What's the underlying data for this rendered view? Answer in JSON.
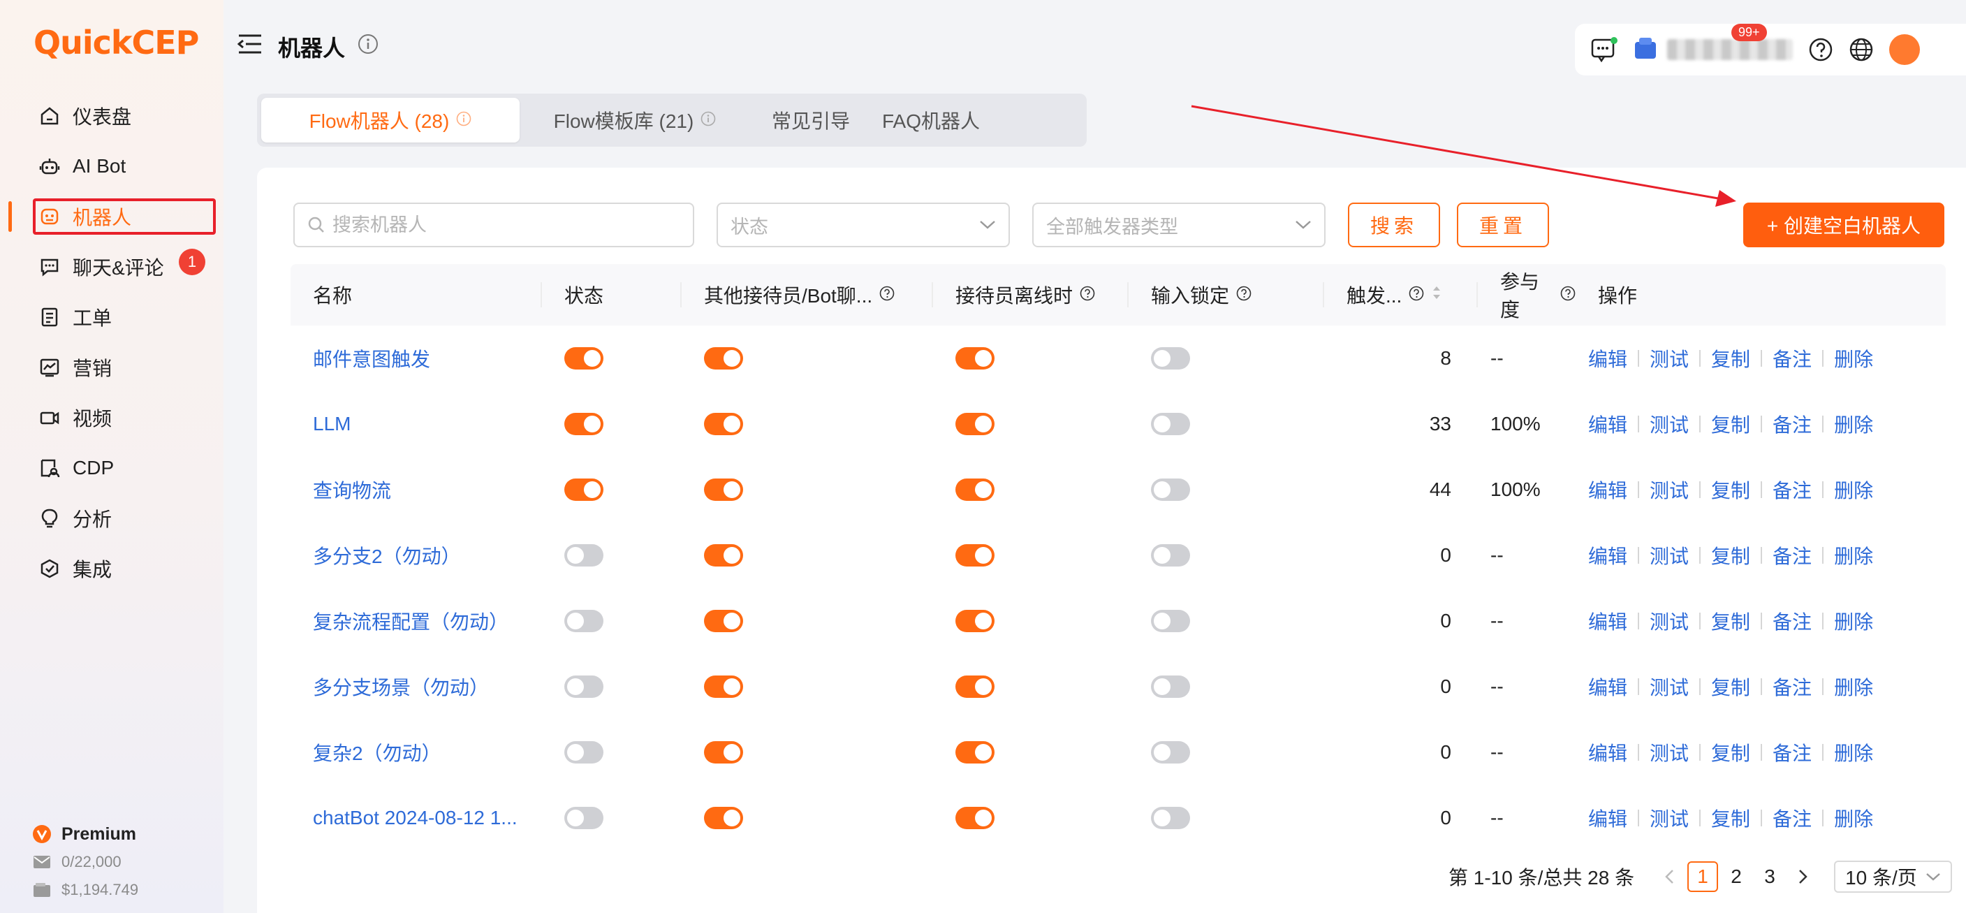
{
  "brand": {
    "logo_text": "QuickCEP",
    "accent": "#ff6a12"
  },
  "sidebar": {
    "items": [
      {
        "label": "仪表盘",
        "icon": "home-icon"
      },
      {
        "label": "AI Bot",
        "icon": "robot-icon"
      },
      {
        "label": "机器人",
        "icon": "bot-icon",
        "active": true
      },
      {
        "label": "聊天&评论",
        "icon": "chat-icon",
        "badge": "1"
      },
      {
        "label": "工单",
        "icon": "ticket-icon"
      },
      {
        "label": "营销",
        "icon": "marketing-icon"
      },
      {
        "label": "视频",
        "icon": "video-icon"
      },
      {
        "label": "CDP",
        "icon": "cdp-icon"
      },
      {
        "label": "分析",
        "icon": "bulb-icon"
      },
      {
        "label": "集成",
        "icon": "integration-icon"
      }
    ],
    "plan": {
      "name": "Premium",
      "emails": "0/22,000",
      "balance": "$1,194.749"
    }
  },
  "header": {
    "title": "机器人",
    "notification_badge": "99+"
  },
  "tabs": [
    {
      "label": "Flow机器人 (28)",
      "active": true,
      "info": true
    },
    {
      "label": "Flow模板库 (21)",
      "active": false,
      "info": true
    },
    {
      "label": "常见引导",
      "active": false,
      "info": false
    },
    {
      "label": "FAQ机器人",
      "active": false,
      "info": false
    }
  ],
  "filters": {
    "search_placeholder": "搜索机器人",
    "status_placeholder": "状态",
    "trigger_placeholder": "全部触发器类型",
    "search_button": "搜索",
    "reset_button": "重置",
    "create_button": "+ 创建空白机器人"
  },
  "table": {
    "columns": [
      "名称",
      "状态",
      "其他接待员/Bot聊...",
      "接待员离线时",
      "输入锁定",
      "触发...",
      "参与度",
      "操作"
    ],
    "actions": [
      "编辑",
      "测试",
      "复制",
      "备注",
      "删除"
    ],
    "rows": [
      {
        "name": "邮件意图触发",
        "status": true,
        "other": true,
        "offline": true,
        "lock": false,
        "trigger": "8",
        "engage": "--"
      },
      {
        "name": "LLM",
        "status": true,
        "other": true,
        "offline": true,
        "lock": false,
        "trigger": "33",
        "engage": "100%"
      },
      {
        "name": "查询物流",
        "status": true,
        "other": true,
        "offline": true,
        "lock": false,
        "trigger": "44",
        "engage": "100%"
      },
      {
        "name": "多分支2（勿动）",
        "status": false,
        "other": true,
        "offline": true,
        "lock": false,
        "trigger": "0",
        "engage": "--"
      },
      {
        "name": "复杂流程配置（勿动）",
        "status": false,
        "other": true,
        "offline": true,
        "lock": false,
        "trigger": "0",
        "engage": "--"
      },
      {
        "name": "多分支场景（勿动）",
        "status": false,
        "other": true,
        "offline": true,
        "lock": false,
        "trigger": "0",
        "engage": "--"
      },
      {
        "name": "复杂2（勿动）",
        "status": false,
        "other": true,
        "offline": true,
        "lock": false,
        "trigger": "0",
        "engage": "--"
      },
      {
        "name": "chatBot 2024-08-12 1...",
        "status": false,
        "other": true,
        "offline": true,
        "lock": false,
        "trigger": "0",
        "engage": "--"
      }
    ]
  },
  "pagination": {
    "summary": "第 1-10 条/总共 28 条",
    "pages": [
      "1",
      "2",
      "3"
    ],
    "current": "1",
    "page_size": "10 条/页"
  }
}
